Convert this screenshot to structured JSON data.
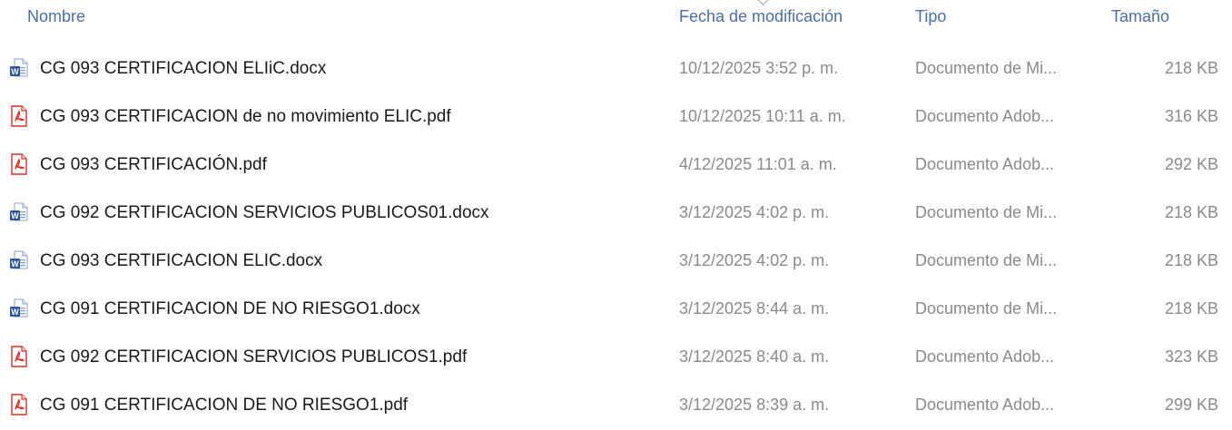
{
  "columns": {
    "name": "Nombre",
    "date": "Fecha de modificación",
    "type": "Tipo",
    "size": "Tamaño"
  },
  "files": [
    {
      "icon": "word-doc-icon",
      "name": "CG 093 CERTIFICACION ELIiC.docx",
      "date": "10/12/2025 3:52 p. m.",
      "type": "Documento de Mi...",
      "size": "218 KB"
    },
    {
      "icon": "pdf-icon",
      "name": "CG 093 CERTIFICACION de no movimiento ELIC.pdf",
      "date": "10/12/2025 10:11 a. m.",
      "type": "Documento Adob...",
      "size": "316 KB"
    },
    {
      "icon": "pdf-icon",
      "name": "CG 093 CERTIFICACIÓN.pdf",
      "date": "4/12/2025 11:01 a. m.",
      "type": "Documento Adob...",
      "size": "292 KB"
    },
    {
      "icon": "word-doc-icon",
      "name": "CG 092 CERTIFICACION SERVICIOS PUBLICOS01.docx",
      "date": "3/12/2025 4:02 p. m.",
      "type": "Documento de Mi...",
      "size": "218 KB"
    },
    {
      "icon": "word-doc-icon",
      "name": "CG 093 CERTIFICACION ELIC.docx",
      "date": "3/12/2025 4:02 p. m.",
      "type": "Documento de Mi...",
      "size": "218 KB"
    },
    {
      "icon": "word-doc-icon",
      "name": "CG 091 CERTIFICACION DE NO RIESGO1.docx",
      "date": "3/12/2025 8:44 a. m.",
      "type": "Documento de Mi...",
      "size": "218 KB"
    },
    {
      "icon": "pdf-icon",
      "name": "CG 092 CERTIFICACION SERVICIOS PUBLICOS1.pdf",
      "date": "3/12/2025 8:40 a. m.",
      "type": "Documento Adob...",
      "size": "323 KB"
    },
    {
      "icon": "pdf-icon",
      "name": "CG 091 CERTIFICACION DE NO RIESGO1.pdf",
      "date": "3/12/2025 8:39 a. m.",
      "type": "Documento Adob...",
      "size": "299 KB"
    }
  ],
  "colors": {
    "header_text": "#4a6fa5",
    "name_text": "#1a1a1a",
    "meta_text": "#8a8a8a",
    "word_blue": "#2b579a",
    "pdf_red": "#d9312a"
  }
}
